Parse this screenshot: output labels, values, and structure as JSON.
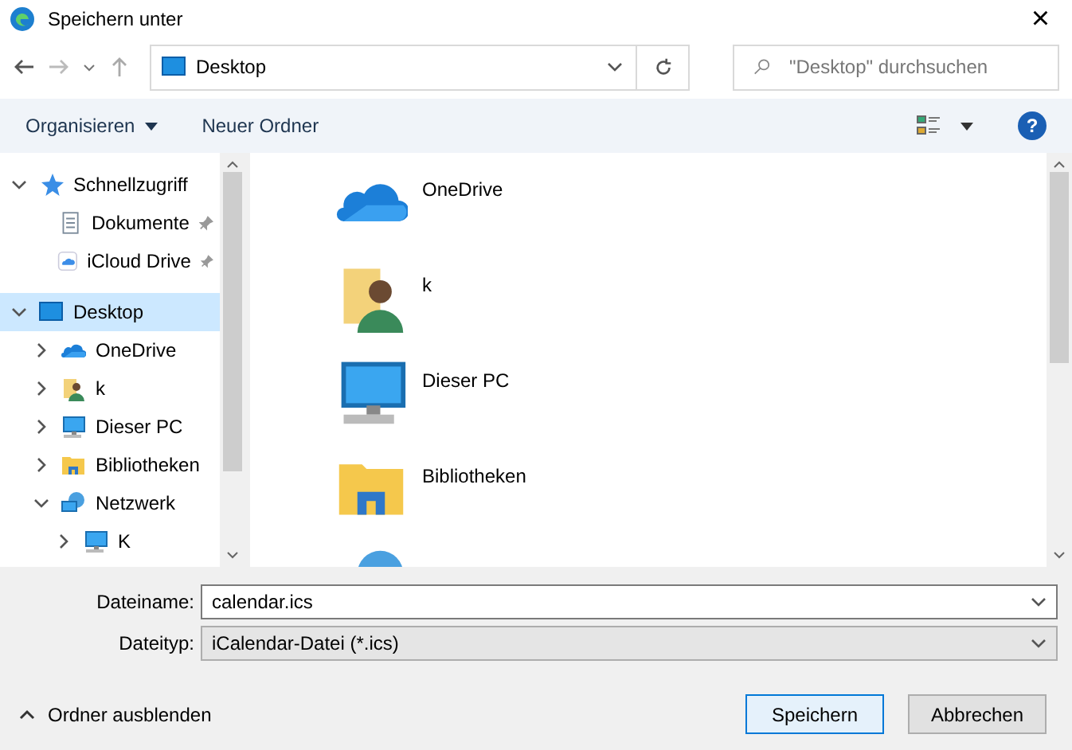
{
  "window": {
    "title": "Speichern unter",
    "close": "×"
  },
  "address": {
    "location": "Desktop",
    "search_placeholder": "\"Desktop\" durchsuchen"
  },
  "toolbar": {
    "organize": "Organisieren",
    "new_folder": "Neuer Ordner",
    "help": "?"
  },
  "sidebar": {
    "items": [
      {
        "label": "Schnellzugriff",
        "kind": "star",
        "expanded": true,
        "selected": false,
        "children": [
          {
            "label": "Dokumente",
            "kind": "document",
            "pinned": true,
            "selected": false
          },
          {
            "label": "iCloud Drive",
            "kind": "cloud-app",
            "pinned": true,
            "selected": false
          }
        ]
      },
      {
        "label": "Desktop",
        "kind": "monitor",
        "expanded": true,
        "selected": true,
        "children": [
          {
            "label": "OneDrive",
            "kind": "onedrive",
            "expanded": false,
            "selected": false
          },
          {
            "label": "k",
            "kind": "user",
            "expanded": false,
            "selected": false
          },
          {
            "label": "Dieser PC",
            "kind": "pc",
            "expanded": false,
            "selected": false
          },
          {
            "label": "Bibliotheken",
            "kind": "library",
            "expanded": false,
            "selected": false
          },
          {
            "label": "Netzwerk",
            "kind": "network",
            "expanded": true,
            "selected": false,
            "children": [
              {
                "label": "K",
                "kind": "pc",
                "expanded": false,
                "selected": false
              }
            ]
          }
        ]
      }
    ]
  },
  "files": [
    {
      "label": "OneDrive",
      "kind": "onedrive"
    },
    {
      "label": "k",
      "kind": "user"
    },
    {
      "label": "Dieser PC",
      "kind": "pc"
    },
    {
      "label": "Bibliotheken",
      "kind": "library"
    },
    {
      "kind": "network"
    }
  ],
  "form": {
    "filename_label": "Dateiname:",
    "filename": "calendar.ics",
    "filetype_label": "Dateityp:",
    "filetype": "iCalendar-Datei (*.ics)"
  },
  "footer": {
    "hide_folders": "Ordner ausblenden",
    "save": "Speichern",
    "cancel": "Abbrechen"
  }
}
